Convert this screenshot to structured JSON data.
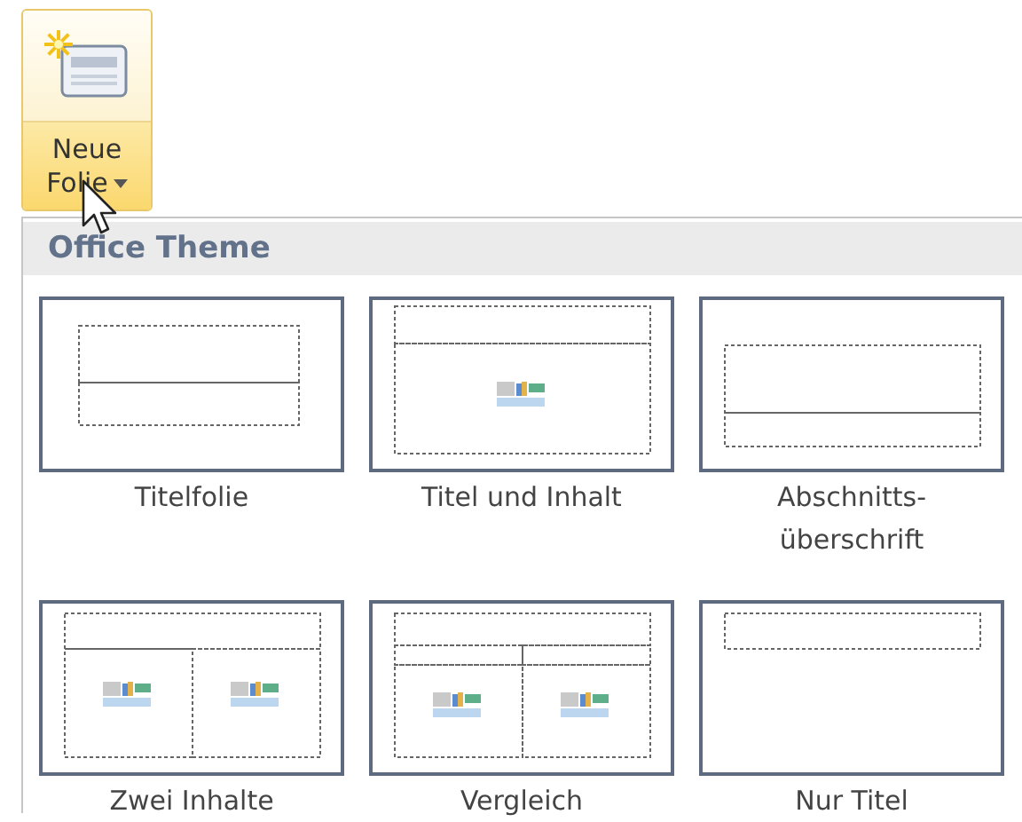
{
  "new_slide_button": {
    "label": "Neue\nFolie",
    "expanded": true
  },
  "gallery": {
    "title": "Office Theme",
    "layouts": [
      {
        "kind": "title",
        "label": "Titelfolie"
      },
      {
        "kind": "title-content",
        "label": "Titel und Inhalt"
      },
      {
        "kind": "section",
        "label": "Abschnitts-\nüberschrift"
      },
      {
        "kind": "two-content",
        "label": "Zwei Inhalte"
      },
      {
        "kind": "comparison",
        "label": "Vergleich"
      },
      {
        "kind": "title-only",
        "label": "Nur Titel"
      }
    ]
  }
}
